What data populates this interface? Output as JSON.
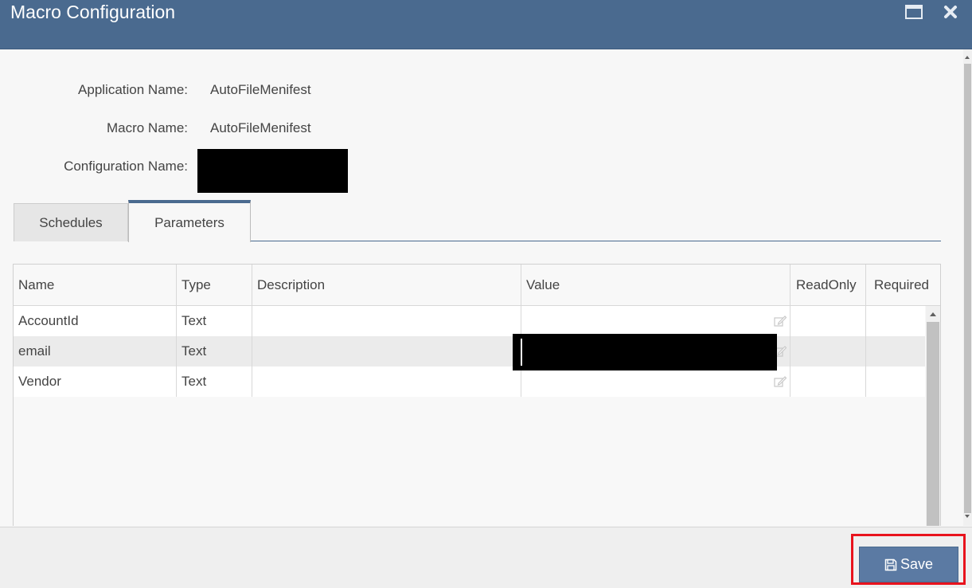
{
  "window": {
    "title": "Macro Configuration"
  },
  "fields": {
    "application_label": "Application Name:",
    "application_value": "AutoFileMenifest",
    "macro_label": "Macro Name:",
    "macro_value": "AutoFileMenifest",
    "configuration_label": "Configuration Name:"
  },
  "tabs": [
    {
      "label": "Schedules",
      "active": false
    },
    {
      "label": "Parameters",
      "active": true
    }
  ],
  "grid": {
    "columns": [
      "Name",
      "Type",
      "Description",
      "Value",
      "ReadOnly",
      "Required"
    ],
    "rows": [
      {
        "name": "AccountId",
        "type": "Text",
        "description": "",
        "value": "",
        "readonly": "",
        "required": ""
      },
      {
        "name": "email",
        "type": "Text",
        "description": "",
        "value": "",
        "readonly": "",
        "required": ""
      },
      {
        "name": "Vendor",
        "type": "Text",
        "description": "",
        "value": "",
        "readonly": "",
        "required": ""
      }
    ]
  },
  "footer": {
    "save_label": "Save"
  },
  "colors": {
    "titlebar": "#4a6a8f",
    "save_button": "#5b7aa3",
    "highlight": "#e8131d"
  },
  "icons": [
    "maximize-icon",
    "close-icon",
    "edit-icon",
    "floppy-disk-icon"
  ]
}
